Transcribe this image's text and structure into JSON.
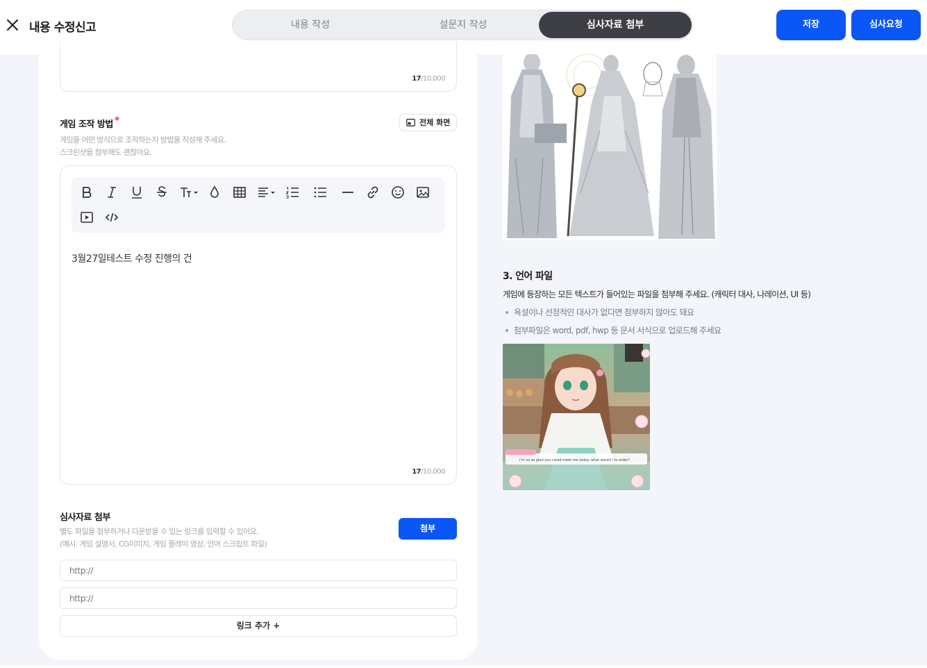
{
  "header": {
    "title": "내용 수정신고",
    "steps": [
      "내용 작성",
      "설문지 작성",
      "심사자료 첨부"
    ],
    "active_step": 2,
    "save_label": "저장",
    "request_label": "심사요청"
  },
  "prev_editor": {
    "count": "17",
    "max": "/10,000"
  },
  "controls_section": {
    "label": "게임 조작 방법",
    "required_mark": "*",
    "desc_line1": "게임을 어떤 방식으로 조작하는지 방법을 작성해 주세요.",
    "desc_line2": "스크린샷을 첨부해도 괜찮아요.",
    "fullscreen_label": "전체 화면",
    "toolbar_icons": [
      "bold-icon",
      "italic-icon",
      "underline-icon",
      "strikethrough-icon",
      "text-size-icon",
      "color-drop-icon",
      "table-icon",
      "align-icon",
      "ordered-list-icon",
      "bullet-list-icon",
      "horizontal-rule-icon",
      "link-icon",
      "emoji-icon",
      "image-icon",
      "video-icon",
      "code-icon"
    ],
    "content": "3월27일테스트 수정 진행의 건",
    "count": "17",
    "max": "/10,000"
  },
  "attachments": {
    "label": "심사자료 첨부",
    "desc_line1": "별도 파일을 첨부하거나 다운받을 수 있는 링크를 입력할 수 있어요.",
    "desc_line2": "(예시. 게임 설명서, CG이미지, 게임 플레이 영상, 언어 스크립트 파일)",
    "attach_label": "첨부",
    "link_placeholder_1": "http://",
    "link_placeholder_2": "http://",
    "add_link_label": "링크 추가 +"
  },
  "guide": {
    "title": "3. 언어 파일",
    "desc": "게임에 등장하는 모든 텍스트가 들어있는 파일을 첨부해 주세요. (캐릭터 대사, 나레이션, UI 등)",
    "bullets": [
      "욕설이나 선정적인 대사가 없다면 첨부하지 않아도 돼요",
      "첨부파일은 word, pdf, hwp 등 문서 서식으로 업로드해 주세요"
    ],
    "example_dialogue": "I'm so so glad you could meet me today. what would I to order?"
  },
  "colors": {
    "accent": "#0b57f6",
    "active_step": "#3d3f44",
    "required": "#ee3b3b"
  }
}
